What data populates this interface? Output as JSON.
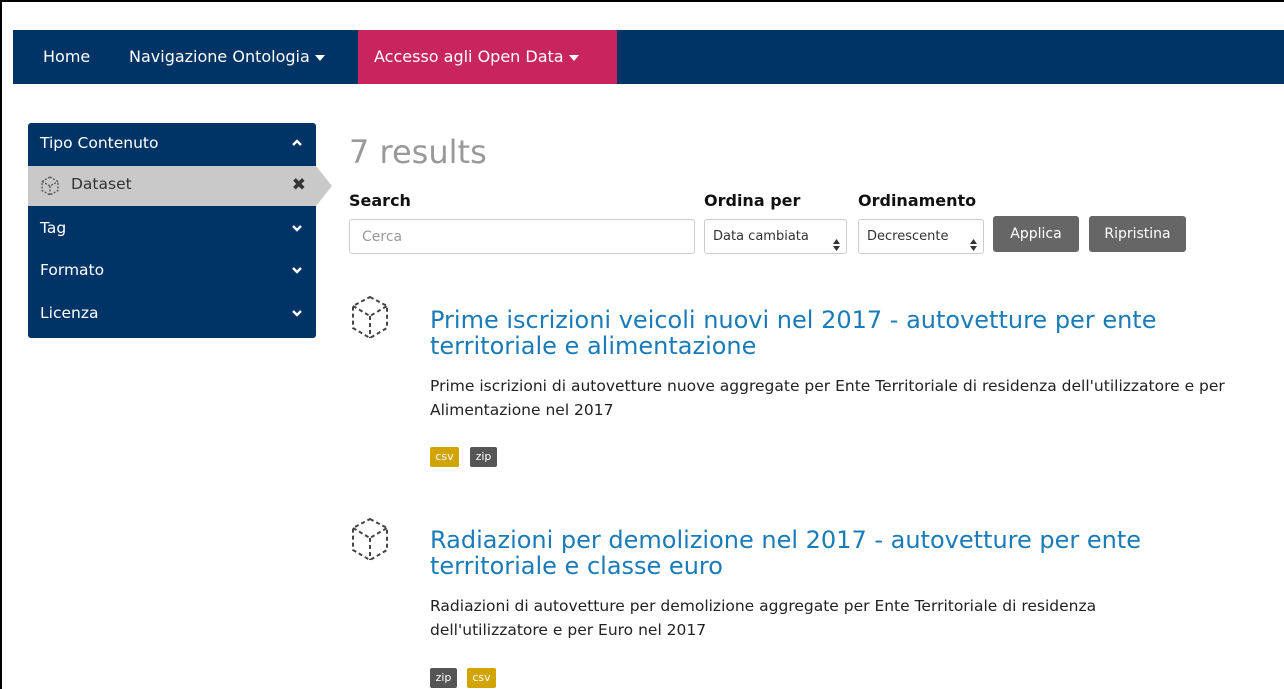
{
  "navbar": {
    "home": "Home",
    "ontology": "Navigazione Ontologia",
    "opendata": "Accesso agli Open Data"
  },
  "sidebar": {
    "sections": [
      {
        "label": "Tipo Contenuto",
        "expanded": true
      },
      {
        "label": "Tag",
        "expanded": false
      },
      {
        "label": "Formato",
        "expanded": false
      },
      {
        "label": "Licenza",
        "expanded": false
      }
    ],
    "selected_filter": {
      "label": "Dataset",
      "icon": "cube-icon"
    }
  },
  "main": {
    "results_count": "7 results",
    "search_label": "Search",
    "search_placeholder": "Cerca",
    "sort_label": "Ordina per",
    "sort_value": "Data cambiata",
    "order_label": "Ordinamento",
    "order_value": "Decrescente",
    "apply_button": "Applica",
    "reset_button": "Ripristina"
  },
  "results": [
    {
      "title": "Prime iscrizioni veicoli nuovi nel 2017 - autovetture per ente territoriale e alimentazione",
      "description": "Prime iscrizioni di autovetture nuove aggregate per Ente Territoriale di residenza dell'utilizzatore e per Alimentazione nel 2017",
      "formats": [
        "csv",
        "zip"
      ]
    },
    {
      "title": "Radiazioni per demolizione nel 2017 - autovetture per ente territoriale e classe euro",
      "description": "Radiazioni di autovetture per demolizione aggregate per Ente Territoriale di residenza dell'utilizzatore e per Euro nel 2017",
      "formats": [
        "zip",
        "csv"
      ]
    }
  ],
  "colors": {
    "navbar": "#003366",
    "accent": "#c8245d",
    "link": "#1a7bb9",
    "csv_badge": "#d1a400",
    "zip_badge": "#555555"
  }
}
